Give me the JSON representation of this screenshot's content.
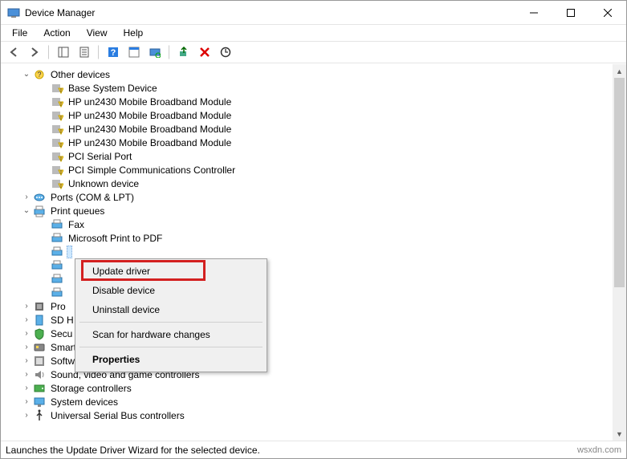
{
  "window": {
    "title": "Device Manager"
  },
  "menu": {
    "file": "File",
    "action": "Action",
    "view": "View",
    "help": "Help"
  },
  "tree": {
    "other_devices": "Other devices",
    "base_system": "Base System Device",
    "hp_broadband": "HP un2430 Mobile Broadband Module",
    "pci_serial": "PCI Serial Port",
    "pci_simple": "PCI Simple Communications Controller",
    "unknown": "Unknown device",
    "ports": "Ports (COM & LPT)",
    "print_queues": "Print queues",
    "fax": "Fax",
    "ms_print_pdf": "Microsoft Print to PDF",
    "processors": "Pro",
    "sd_host": "SD H",
    "security": "Secu",
    "smart_card": "Smart card readers",
    "software": "Software devices",
    "sound": "Sound, video and game controllers",
    "storage": "Storage controllers",
    "system": "System devices",
    "usb": "Universal Serial Bus controllers"
  },
  "context": {
    "update": "Update driver",
    "disable": "Disable device",
    "uninstall": "Uninstall device",
    "scan": "Scan for hardware changes",
    "properties": "Properties"
  },
  "status": {
    "text": "Launches the Update Driver Wizard for the selected device.",
    "brand": "wsxdn.com"
  }
}
